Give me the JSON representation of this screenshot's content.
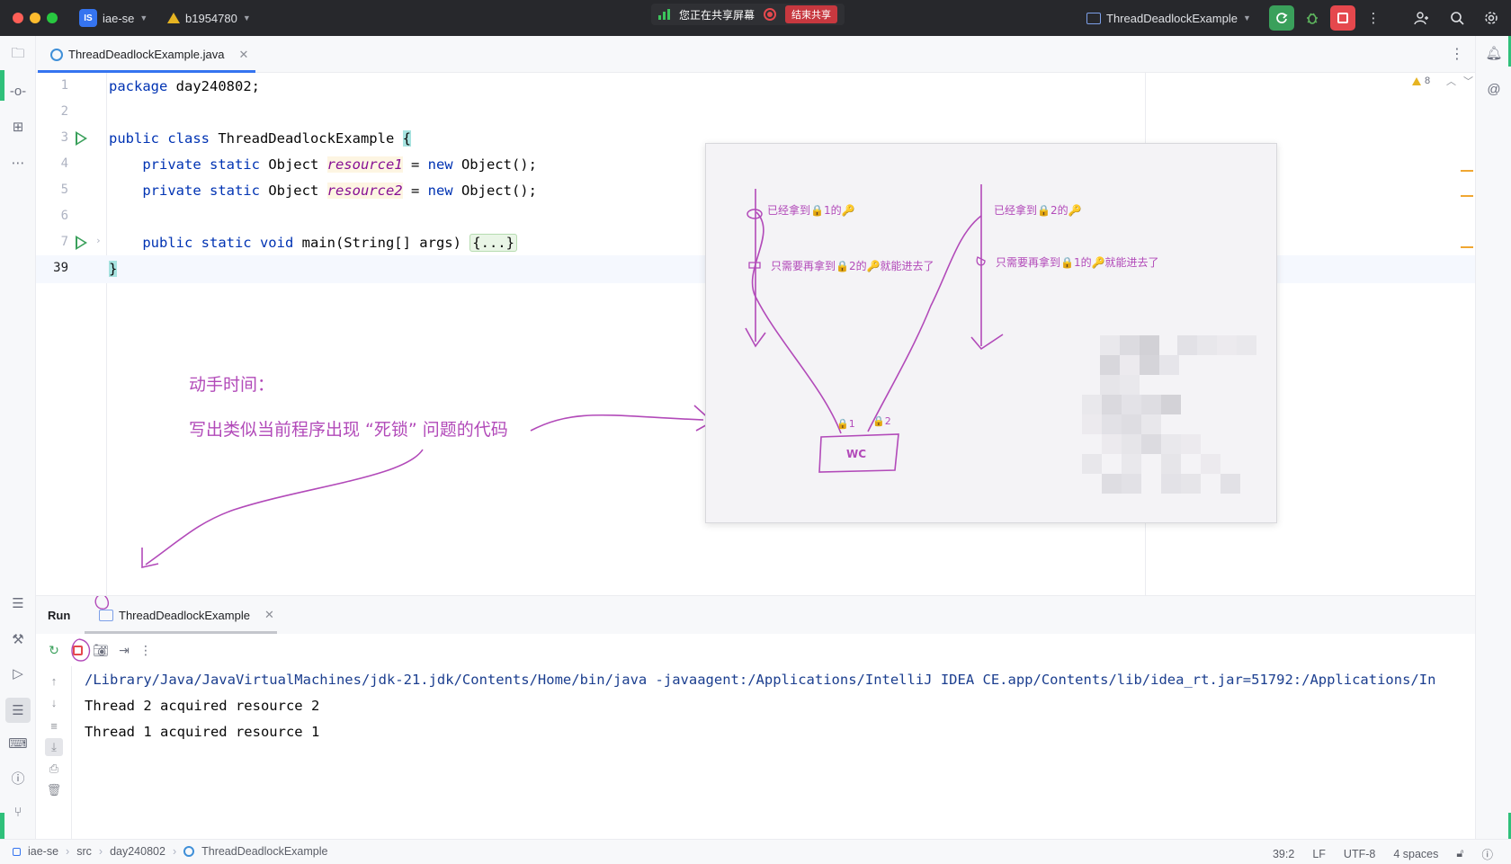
{
  "titlebar": {
    "project_badge": "IS",
    "project_name": "iae-se",
    "branch": "b1954780",
    "share_status": "您正在共享屏幕",
    "stop_share": "结束共享",
    "run_config": "ThreadDeadlockExample"
  },
  "editor": {
    "tab_label": "ThreadDeadlockExample.java",
    "warnings_count": "8",
    "lines": [
      {
        "num": "1"
      },
      {
        "num": "2"
      },
      {
        "num": "3"
      },
      {
        "num": "4"
      },
      {
        "num": "5"
      },
      {
        "num": "6"
      },
      {
        "num": "7"
      },
      {
        "num": "39"
      }
    ],
    "code": {
      "l1_kw": "package",
      "l1_rest": " day240802;",
      "l3_kw": "public class",
      "l3_name": " ThreadDeadlockExample ",
      "l3_brace": "{",
      "l4_indent": "    ",
      "l4_kw": "private static",
      "l4_type": " Object ",
      "l4_field": "resource1",
      "l4_eq": " = ",
      "l4_new": "new",
      "l4_rest": " Object();",
      "l5_indent": "    ",
      "l5_kw": "private static",
      "l5_type": " Object ",
      "l5_field": "resource2",
      "l5_eq": " = ",
      "l5_new": "new",
      "l5_rest": " Object();",
      "l7_indent": "    ",
      "l7_kw": "public static void",
      "l7_sig": " main(String[] args) ",
      "l7_folded": "{...}",
      "l39_brace": "}"
    }
  },
  "annotation": {
    "heading": "动手时间：",
    "task": "写出类似当前程序出现 “死锁” 问题的代码"
  },
  "sketch": {
    "left_top": "已经拿到🔒1的🔑",
    "left_bottom": "只需要再拿到🔒2的🔑就能进去了",
    "right_top": "已经拿到🔒2的🔑",
    "right_bottom": "只需要再拿到🔒1的🔑就能进去了",
    "lock1": "🔒1",
    "lock2": "🔒2",
    "box_label": "WC"
  },
  "run": {
    "title": "Run",
    "tab_label": "ThreadDeadlockExample",
    "console_lines": [
      "/Library/Java/JavaVirtualMachines/jdk-21.jdk/Contents/Home/bin/java -javaagent:/Applications/IntelliJ IDEA CE.app/Contents/lib/idea_rt.jar=51792:/Applications/In",
      "Thread 2 acquired resource 2",
      "Thread 1 acquired resource 1"
    ]
  },
  "statusbar": {
    "crumbs": [
      "iae-se",
      "src",
      "day240802",
      "ThreadDeadlockExample"
    ],
    "position": "39:2",
    "line_sep": "LF",
    "encoding": "UTF-8",
    "indent": "4 spaces"
  },
  "colors": {
    "accent": "#3574f0",
    "annotation_ink": "#b24ab9",
    "run_green": "#3aa05b",
    "stop_red": "#e5484d"
  }
}
